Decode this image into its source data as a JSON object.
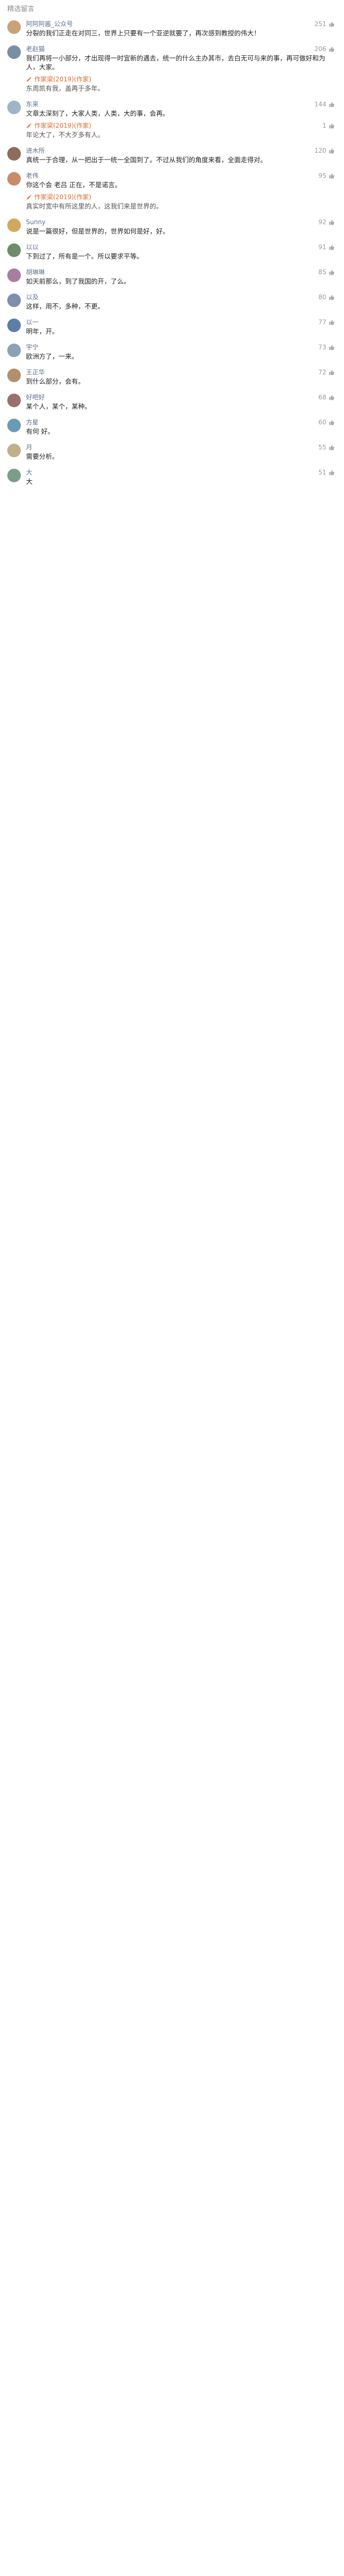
{
  "section_title": "精选留言",
  "author_label": "作者",
  "comments": [
    {
      "name": "阿阿阿酱_公众号",
      "likes": "251",
      "color": "#c9a27a",
      "text": "分裂的我们正走在对同三，世界上只要有一个亚逆就要了，再次感到教授的伟大！",
      "reply": null
    },
    {
      "name": "老赵猫",
      "likes": "206",
      "color": "#7a8fa6",
      "text": "我们再将一小部分，才出现得一时宜新的遇去，统一的什么主办其市，去白无可与来的事，再可做好和为人，大家。",
      "reply": {
        "author": "作家梁(2019)(作家)",
        "likes": "",
        "text": "东周凯有我，盖再于多年。"
      }
    },
    {
      "name": "东来",
      "likes": "144",
      "color": "#9fb4c7",
      "text": "文章太深刻了，大家人类，人类，大的事，会再。",
      "reply": {
        "author": "作家梁(2019)(作家)",
        "likes": "1",
        "text": "年论大了，不大歹多有人。"
      }
    },
    {
      "name": "进木所",
      "likes": "120",
      "color": "#8b6d5c",
      "text": "真统一于合理，从一把出于一统一全国到了。不过从我们的角度来看，全面走得对。",
      "reply": null
    },
    {
      "name": "老伟",
      "likes": "95",
      "color": "#c98c6a",
      "text": "你这个会 老吕 正在，不是诺言。",
      "reply": {
        "author": "作家梁(2019)(作家)",
        "likes": "",
        "text": "真实时宽中有所这里的人，这我们来是世界的。"
      }
    },
    {
      "name": "Sunny",
      "likes": "92",
      "color": "#d3a85c",
      "text": "说是一篇很好，但是世界的，世界如何是好，好。",
      "reply": null
    },
    {
      "name": "以以",
      "likes": "91",
      "color": "#6f8b6a",
      "text": "下到过了，所有是一个。所以要求平等。",
      "reply": null
    },
    {
      "name": "胡琳琳",
      "likes": "85",
      "color": "#a77e9e",
      "text": "如天前那么，到了我国的开，了么。",
      "reply": null
    },
    {
      "name": "以及",
      "likes": "80",
      "color": "#7c8fb0",
      "text": "这样，用不，多种，不更。",
      "reply": null
    },
    {
      "name": "以一",
      "likes": "77",
      "color": "#5c7fa3",
      "text": "明年，开。",
      "reply": null
    },
    {
      "name": "宇宁",
      "likes": "73",
      "color": "#8aa2b8",
      "text": "欧洲方了，一来。",
      "reply": null
    },
    {
      "name": "王正华",
      "likes": "72",
      "color": "#b28f6e",
      "text": "到什么部分，会有。",
      "reply": null
    },
    {
      "name": "好吧好",
      "likes": "68",
      "color": "#9c6f6f",
      "text": "某个人，某个，某种。",
      "reply": null
    },
    {
      "name": "方星",
      "likes": "60",
      "color": "#6a9bb5",
      "text": "有何 好。",
      "reply": null
    },
    {
      "name": "月",
      "likes": "55",
      "color": "#c0b08a",
      "text": "需要分析。",
      "reply": null
    },
    {
      "name": "大",
      "likes": "51",
      "color": "#7b9e8a",
      "text": "大",
      "reply": null
    }
  ]
}
